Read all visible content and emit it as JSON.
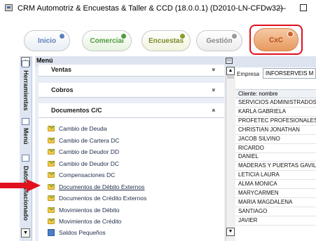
{
  "window": {
    "title": "CRM Automotriz & Encuestas & Taller & CCD (18.0.0.1) (D2010-LN-CFDw32)",
    "minimize_glyph": "—"
  },
  "tabs": [
    {
      "label": "Inicio"
    },
    {
      "label": "Comercial"
    },
    {
      "label": "Encuestas"
    },
    {
      "label": "Gestión"
    },
    {
      "label": "CxC",
      "active": true
    }
  ],
  "sidebar": {
    "tabs": [
      "Herramientas",
      "Menú",
      "Datos relacionado"
    ],
    "scroll_up": "▲",
    "scroll_down": "▼"
  },
  "menu": {
    "title": "Menú",
    "pin": "▭",
    "sections": [
      {
        "label": "Ventas",
        "state": "collapsed",
        "chevron": "»"
      },
      {
        "label": "Cobros",
        "state": "collapsed",
        "chevron": "»"
      },
      {
        "label": "Documentos C/C",
        "state": "expanded",
        "chevron": "«"
      }
    ],
    "items": [
      {
        "label": "Cambio de Deuda",
        "icon": "folder-check-icon"
      },
      {
        "label": "Cambio de Cartera DC",
        "icon": "folder-check-icon"
      },
      {
        "label": "Cambio de Deudor DD",
        "icon": "folder-check-icon"
      },
      {
        "label": "Cambio de Deudor DC",
        "icon": "folder-check-icon"
      },
      {
        "label": "Compensaciones DC",
        "icon": "folder-check-icon"
      },
      {
        "label": "Documentos de Débito Externos",
        "icon": "folder-check-icon",
        "highlighted": true
      },
      {
        "label": "Documentos de Crédito Externos",
        "icon": "folder-check-icon"
      },
      {
        "label": "Movimientos de Débito",
        "icon": "folder-check-icon"
      },
      {
        "label": "Movimientos de Crédito",
        "icon": "folder-check-icon"
      },
      {
        "label": "Saldos Pequeños",
        "icon": "calculator-icon"
      }
    ],
    "scroll_up": "▲",
    "scroll_down": "▼"
  },
  "data_panel": {
    "empresa_label": "Empresa",
    "empresa_value": "INFORSERVEIS M",
    "column_header": "Cliente: nombre",
    "rows": [
      "SERVICIOS ADMINISTRADOS",
      "KARLA GABRIELA",
      "PROFETEC PROFESIONALES E",
      "CHRISTIAN JONATHAN",
      "JACOB SILVINO",
      "RICARDO",
      "DANIEL",
      "MADERAS Y PUERTAS GAVILA",
      "LETICIA LAURA",
      "ALMA MONICA",
      "MARYCARMEN",
      "MARIA MAGDALENA",
      "SANTIAGO",
      "JAVIER"
    ]
  },
  "colors": {
    "annotation_red": "#e0101d",
    "active_tab": "#e79a5f",
    "panel_header": "#dde4ef"
  }
}
